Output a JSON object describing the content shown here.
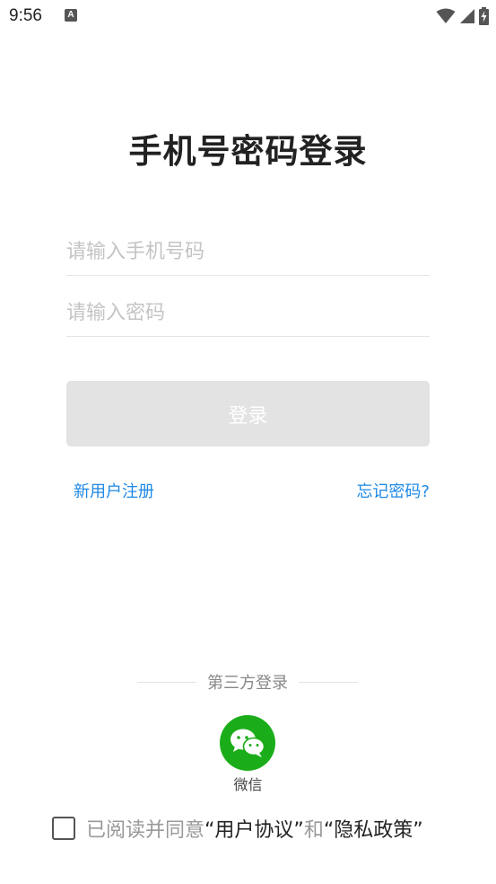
{
  "status_bar": {
    "time": "9:56",
    "notification_icon": "a-notification-icon",
    "icons": [
      "wifi-icon",
      "signal-icon",
      "battery-charging-icon"
    ]
  },
  "title": "手机号密码登录",
  "form": {
    "phone_placeholder": "请输入手机号码",
    "password_placeholder": "请输入密码",
    "login_label": "登录"
  },
  "links": {
    "register": "新用户注册",
    "forgot": "忘记密码?"
  },
  "third_party": {
    "title": "第三方登录",
    "wechat_label": "微信"
  },
  "agreement": {
    "prefix": "已阅读并同意",
    "user_agreement": "“用户协议”",
    "and": "和",
    "privacy_policy": "“隐私政策”",
    "checked": false
  },
  "colors": {
    "link": "#1e88e5",
    "wechat": "#1aad19",
    "button_disabled": "#e3e3e3"
  }
}
